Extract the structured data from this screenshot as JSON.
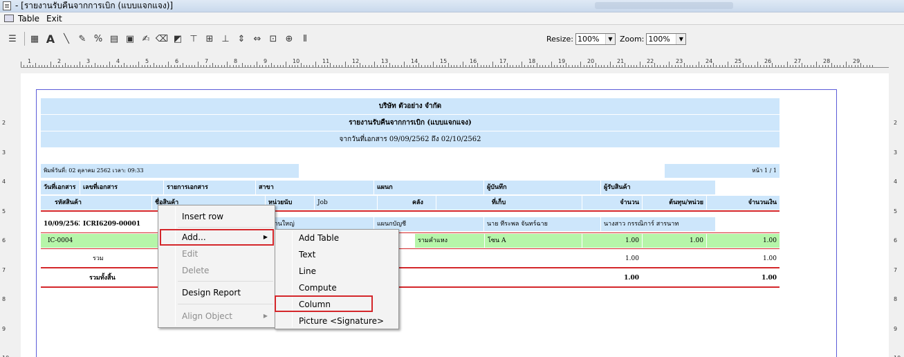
{
  "window": {
    "title": "- [รายงานรับคืนจากการเบิก (แบบแจกแจง)]"
  },
  "menubar": {
    "items": [
      "Table",
      "Exit"
    ]
  },
  "toolbar": {
    "resize_label": "Resize:",
    "resize_value": "100%",
    "zoom_label": "Zoom:",
    "zoom_value": "100%"
  },
  "ruler": {
    "top_labels": [
      "1",
      "2",
      "3",
      "4",
      "5",
      "6",
      "7",
      "8",
      "9",
      "10",
      "11",
      "12",
      "13",
      "14",
      "15",
      "16",
      "17",
      "18",
      "19",
      "20",
      "21",
      "22",
      "23",
      "24",
      "25",
      "26",
      "27",
      "28",
      "29"
    ],
    "side_labels": [
      "2",
      "3",
      "4",
      "5",
      "6",
      "7",
      "8",
      "9",
      "10"
    ]
  },
  "report": {
    "company": "บริษัท ตัวอย่าง จำกัด",
    "report_title": "รายงานรับคืนจากการเบิก (แบบแจกแจง)",
    "date_range": "จากวันที่เอกสาร 09/09/2562 ถึง 02/10/2562",
    "print_info": "พิมพ์วันที่: 02 ตุลาคม 2562 เวลา: 09:33",
    "page_info": "หน้า 1 / 1",
    "header_row1": [
      "วันที่เอกสาร",
      "เลขที่เอกสาร",
      "รายการเอกสาร",
      "สาขา",
      "แผนก",
      "ผู้บันทึก",
      "ผู้รับสินค้า"
    ],
    "header_row2": [
      "รหัสสินค้า",
      "ชื่อสินค้า",
      "หน่วยนับ",
      "Job",
      "คลัง",
      "ที่เก็บ",
      "จำนวน",
      "ต้นทุน/หน่วย",
      "จำนวนเงิน"
    ],
    "doc_row": [
      "10/09/2562",
      "ICRI6209-00001",
      "สำนักงานใหญ่",
      "แผนกบัญชี",
      "นาย ทีระพล จันทร์ฉาย",
      "นางสาว กรรณิการ์ สารนาท"
    ],
    "item_row": [
      "IC-0004",
      "รามคำแหง",
      "โซน A",
      "1.00",
      "1.00",
      "1.00"
    ],
    "sum_label": "รวม",
    "sum_values": [
      "1.00",
      "1.00"
    ],
    "total_label": "รวมทั้งสิ้น",
    "total_values": [
      "1.00",
      "1.00"
    ]
  },
  "context_menu": {
    "items": [
      "Insert row",
      "Add...",
      "Edit",
      "Delete",
      "Design Report",
      "Align Object"
    ]
  },
  "submenu": {
    "items": [
      "Add Table",
      "Text",
      "Line",
      "Compute",
      "Column",
      "Picture <Signature>"
    ]
  },
  "colors": {
    "highlight": "#d4262a",
    "header_blue": "#cde6fb",
    "row_green": "#b6f5a9"
  }
}
